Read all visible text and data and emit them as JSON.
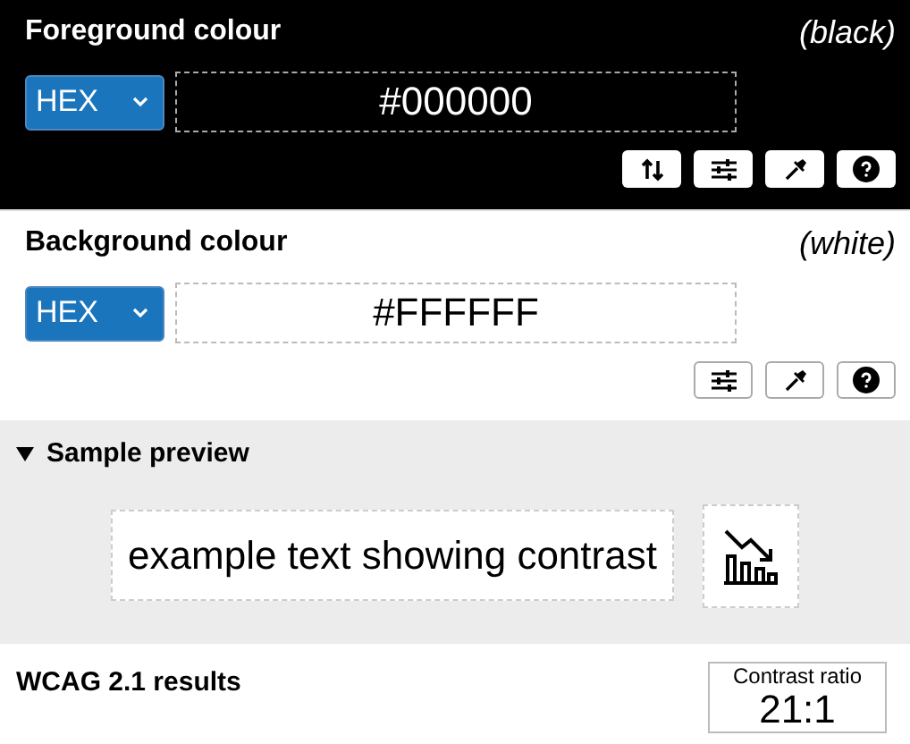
{
  "colour_panels": [
    {
      "kind": "dark",
      "title": "Foreground colour",
      "name": "(black)",
      "format": "HEX",
      "value": "#000000",
      "buttons": [
        {
          "kind": "swap"
        },
        {
          "kind": "adjust"
        },
        {
          "kind": "eyedropper"
        },
        {
          "kind": "help"
        }
      ]
    },
    {
      "kind": "light",
      "title": "Background colour",
      "name": "(white)",
      "format": "HEX",
      "value": "#FFFFFF",
      "buttons": [
        {
          "kind": "adjust"
        },
        {
          "kind": "eyedropper"
        },
        {
          "kind": "help"
        }
      ]
    }
  ],
  "sample_preview": {
    "title": "Sample preview",
    "expanded": true,
    "text": "example text showing contrast"
  },
  "results": {
    "title": "WCAG 2.1 results",
    "ratio_label": "Contrast ratio",
    "ratio": "21:1"
  }
}
